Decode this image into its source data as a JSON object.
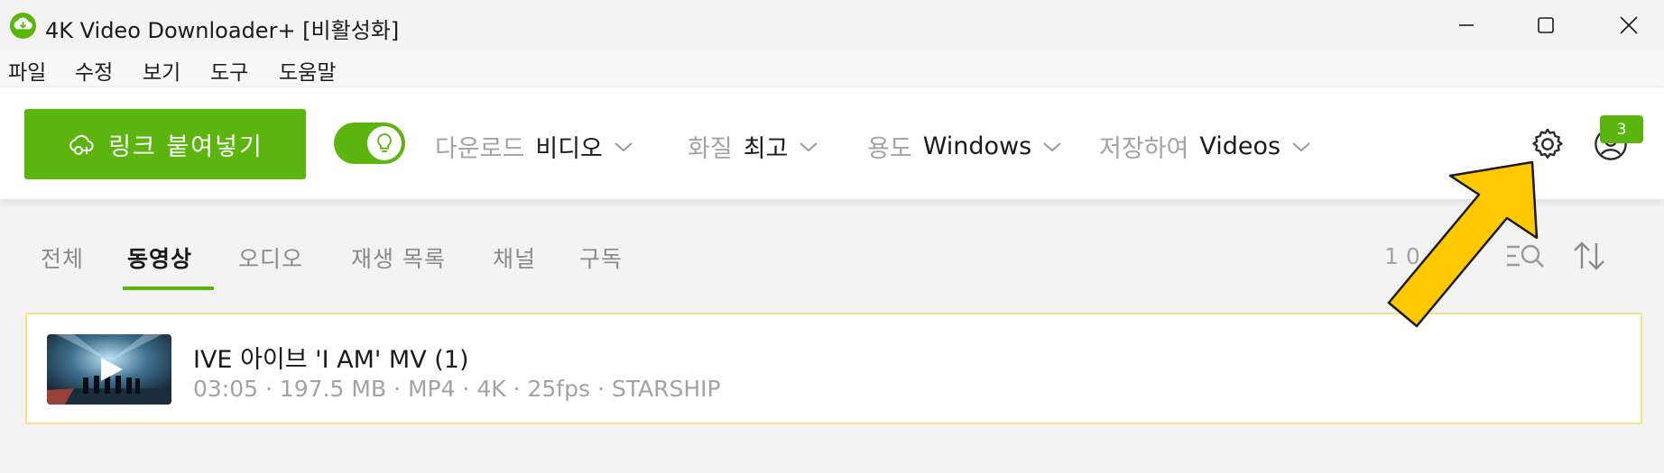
{
  "window": {
    "title": "4K Video Downloader+ [비활성화]",
    "controls": [
      "minimize",
      "maximize",
      "close"
    ]
  },
  "menu": {
    "items": [
      "파일",
      "수정",
      "보기",
      "도구",
      "도움말"
    ]
  },
  "toolbar": {
    "paste_link_label": "링크 붙여넣기",
    "smart_mode_on": true,
    "download": {
      "label": "다운로드",
      "value": "비디오"
    },
    "quality": {
      "label": "화질",
      "value": "최고"
    },
    "usage": {
      "label": "용도",
      "value": "Windows"
    },
    "save_to": {
      "label": "저장하여",
      "value": "Videos"
    },
    "notification_badge": "3"
  },
  "tabs": {
    "items": [
      "전체",
      "동영상",
      "오디오",
      "재생 목록",
      "채널",
      "구독"
    ],
    "active": "동영상"
  },
  "list_header": {
    "count_text": "1 0"
  },
  "downloads": [
    {
      "title": "IVE 아이브 'I AM' MV (1)",
      "meta": "03:05 · 197.5 MB · MP4 · 4K · 25fps · STARSHIP"
    }
  ],
  "colors": {
    "accent_green": "#5cb50e",
    "highlight_border": "#f7e08a",
    "annotation_arrow": "#ffc800"
  },
  "icons": {
    "app_logo": "cloud-download-icon",
    "paste": "link-plus-icon",
    "smart_mode": "lightbulb-icon",
    "settings": "gear-icon",
    "profile": "user-circle-icon",
    "search_list": "search-list-icon",
    "sort": "sort-icon",
    "play": "play-icon"
  }
}
